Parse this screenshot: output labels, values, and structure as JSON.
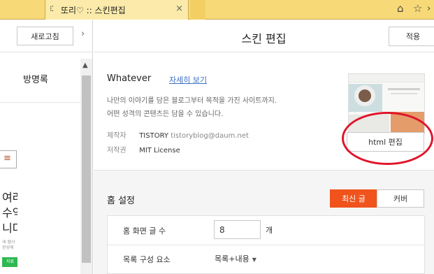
{
  "browser": {
    "tab_icon": "⁝⁚",
    "tab_title": "또리♡ :: 스킨편집",
    "tab_close": "×",
    "home_icon": "home-icon",
    "star_icon": "star-icon"
  },
  "preview": {
    "refresh_label": "새로고침",
    "collapse_icon": "›",
    "guestbook_label": "방명록",
    "menu_icon": "≡",
    "big_text": "여러\n수익\n니다",
    "small_text": "새 웹사\n완성에",
    "green_badge": "자료"
  },
  "header": {
    "title": "스킨 편집",
    "apply_label": "적용"
  },
  "skin": {
    "name": "Whatever",
    "more_link": "자세히 보기",
    "description": "나만의 이야기를 담은 블로그부터 목적을 가진 사이트까지.\n어떤 성격의 콘텐츠든 담을 수 있습니다.",
    "maker_key": "제작자",
    "maker_value": "TISTORY",
    "maker_email": "tistoryblog@daum.net",
    "license_key": "저작권",
    "license_value": "MIT License",
    "html_edit_label": "html 편집",
    "highlight_color": "#e0152a"
  },
  "home_settings": {
    "title": "홈 설정",
    "tab_latest": "최신 글",
    "tab_cover": "커버",
    "accent_color": "#f0531c",
    "post_count_label": "홈 화면 글 수",
    "post_count_value": "8",
    "post_count_unit": "개",
    "list_component_label": "목록 구성 요소",
    "list_component_value": "목록+내용"
  }
}
